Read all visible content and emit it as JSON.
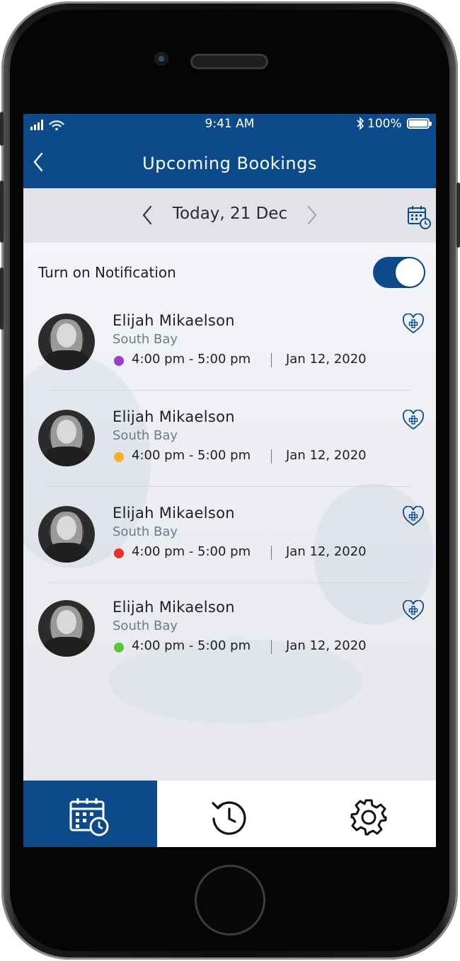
{
  "status_bar": {
    "time": "9:41 AM",
    "battery": "100%"
  },
  "header": {
    "title": "Upcoming Bookings"
  },
  "date_nav": {
    "label": "Today, 21 Dec"
  },
  "notification": {
    "label": "Turn on Notification",
    "enabled": true
  },
  "bookings": [
    {
      "name": "Elijah Mikaelson",
      "location": "South Bay",
      "time": "4:00 pm - 5:00 pm",
      "date": "Jan 12, 2020",
      "color": "#9b3fc8"
    },
    {
      "name": "Elijah Mikaelson",
      "location": "South Bay",
      "time": "4:00 pm - 5:00 pm",
      "date": "Jan 12, 2020",
      "color": "#f4b026"
    },
    {
      "name": "Elijah Mikaelson",
      "location": "South Bay",
      "time": "4:00 pm - 5:00 pm",
      "date": "Jan 12, 2020",
      "color": "#e5332a"
    },
    {
      "name": "Elijah Mikaelson",
      "location": "South Bay",
      "time": "4:00 pm - 5:00 pm",
      "date": "Jan 12, 2020",
      "color": "#5cc438"
    }
  ],
  "tabs": [
    {
      "icon": "calendar-clock-icon",
      "active": true
    },
    {
      "icon": "history-icon",
      "active": false
    },
    {
      "icon": "gear-icon",
      "active": false
    }
  ],
  "colors": {
    "primary": "#0d4a8c",
    "date_bar": "#e2e3e6"
  }
}
